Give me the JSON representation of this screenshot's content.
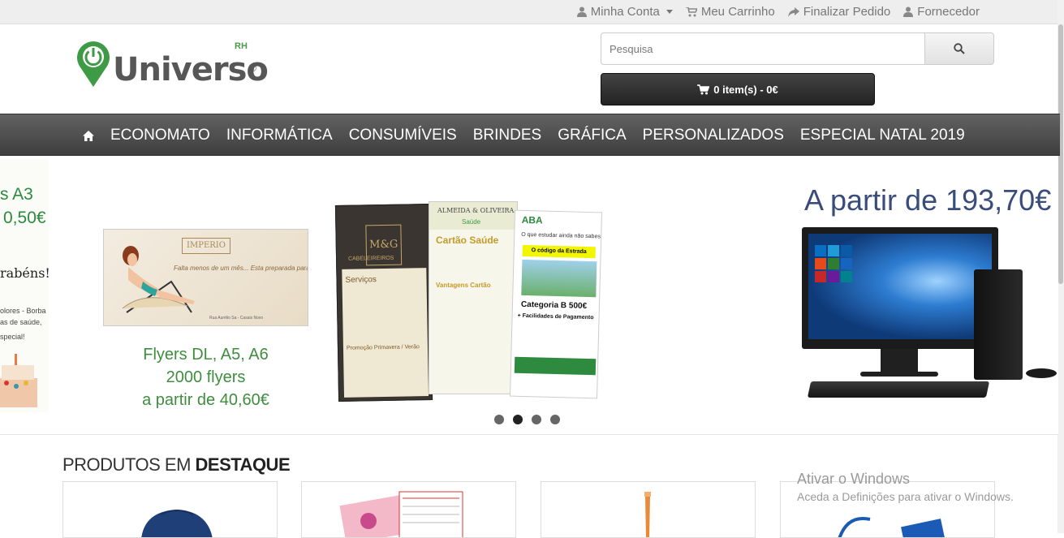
{
  "topbar": {
    "links": [
      {
        "label": "Minha Conta",
        "icon": "user-icon",
        "dropdown": true
      },
      {
        "label": "Meu Carrinho",
        "icon": "cart-icon"
      },
      {
        "label": "Finalizar Pedido",
        "icon": "share-icon"
      },
      {
        "label": "Fornecedor",
        "icon": "user-icon"
      }
    ]
  },
  "logo": {
    "word": "Universo",
    "superscript": "RH",
    "registered": "®"
  },
  "search": {
    "placeholder": "Pesquisa",
    "value": ""
  },
  "cart": {
    "label": "0 item(s) - 0€"
  },
  "nav": {
    "items": [
      "ECONOMATO",
      "INFORMÁTICA",
      "CONSUMÍVEIS",
      "BRINDES",
      "GRÁFICA",
      "PERSONALIZADOS",
      "ESPECIAL NATAL 2019"
    ]
  },
  "slider": {
    "left": {
      "line1": "s A3",
      "line2": "0,50€",
      "line3": "rabéns!",
      "small1": "olores - Borba",
      "small2": "as de saúde,",
      "small3": "special!"
    },
    "flyers": {
      "brand": "IMPERIO",
      "tagline": "Falta menos de um mês... Esta preparada para o Verão?",
      "footer": "Rua Aurélio Sa - Casais Novo",
      "caption1": "Flyers DL, A5, A6",
      "caption2": "2000 flyers",
      "caption3": "a partir de 40,60€"
    },
    "cards": {
      "card1_mg": "M&G",
      "card1_title": "CABELEIREIROS",
      "card1_services": "Serviços",
      "card1_promo": "Promoção Primavera / Verão",
      "card2_brand": "ALMEIDA & OLIVEIRA",
      "card2_sub": "Saúde",
      "card2_title": "Cartão Saúde",
      "card2_adv": "Vantagens Cartão",
      "card3_brand": "ABA",
      "card3_question": "O que estudar ainda não sabes?",
      "card3_bar": "O código da Estrada",
      "card3_category": "Categoria B 500€",
      "card3_payment": "+ Facilidades de Pagamento"
    },
    "pc": {
      "price": "A partir de 193,70€"
    },
    "dots": [
      false,
      true,
      false,
      false
    ]
  },
  "featured": {
    "title_light": "PRODUTOS EM ",
    "title_bold": "DESTAQUE"
  },
  "watermark": {
    "title": "Ativar o Windows",
    "subtitle": "Aceda a Definições para ativar o Windows."
  }
}
